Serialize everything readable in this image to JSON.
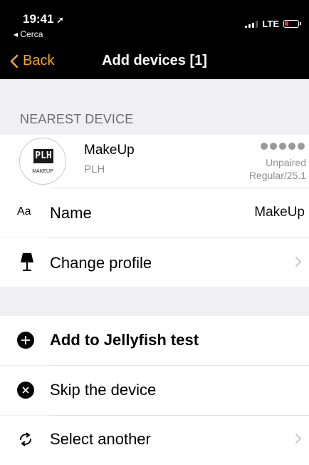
{
  "status_bar": {
    "time": "19:41",
    "back_app": "◂ Cerca",
    "network": "LTE",
    "battery_level": 0.2
  },
  "nav": {
    "back_label": "Back",
    "title": "Add devices [1]"
  },
  "colors": {
    "accent": "#f5a623",
    "battery_low": "#e8302a"
  },
  "section": {
    "header": "NEAREST DEVICE"
  },
  "device": {
    "logo_text": "PLH",
    "logo_caption": "MAKEUP",
    "name": "MakeUp",
    "brand": "PLH",
    "status": "Unpaired",
    "firmware": "Regular/25.1",
    "signal_dots": 5
  },
  "rows": {
    "name": {
      "icon": "Aa",
      "label": "Name",
      "value": "MakeUp"
    },
    "profile": {
      "label": "Change profile"
    },
    "add": {
      "label": "Add to Jellyfish test"
    },
    "skip": {
      "label": "Skip the device"
    },
    "select": {
      "label": "Select another"
    }
  }
}
